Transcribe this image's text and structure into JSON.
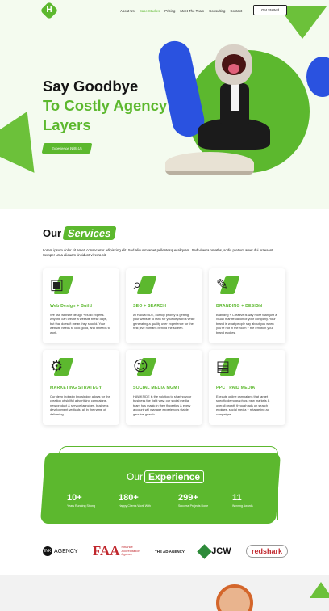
{
  "brand": {
    "logo_letter": "H",
    "accent": "#5cb82e"
  },
  "nav": {
    "items": [
      "About Us",
      "Case Studies",
      "Pricing",
      "Meet The Team",
      "Consulting",
      "Contact"
    ],
    "active": "Case Studies",
    "cta": "Get Started"
  },
  "hero": {
    "line1": "Say Goodbye",
    "line2": "To Costly Agency",
    "line3": "Layers",
    "button": "Experience With Us"
  },
  "services": {
    "title_plain": "Our",
    "title_tag": "Services",
    "intro": "Lorem ipsum dolor sit amet, consectetur adipiscing elit. Sed aliquam amet pellentesque aliquam. Sed viverra ornaths, sodis pretium amet dui praesent. Semper urna aliquam tincidunt viverra sit.",
    "cards": [
      {
        "icon": "web-design-icon",
        "glyph": "▣",
        "title": "Web Design + Build",
        "text": "We use website design + build experts. Anyone can create a website these days, but that doesn't mean they should. Your website needs to look good, and it needs to work."
      },
      {
        "icon": "seo-search-icon",
        "glyph": "⌕",
        "title": "SEO + SEARCH",
        "text": "At HAWKSIDE, our top priority is getting your website to rank for your keywords while generating a quality user experience for the rest; live humans behind the screen."
      },
      {
        "icon": "branding-design-icon",
        "glyph": "✎",
        "title": "BRANDING + DESIGN",
        "text": "Branding + Creative is way more than just a visual manifestation of your company. Your brand is what people say about you when you're not in the room + the emotion your brand evokes."
      },
      {
        "icon": "marketing-strategy-icon",
        "glyph": "⚙",
        "title": "MARKETING STRATEGY",
        "text": "Our deep industry knowledge allows for the creation of skillful advertising campaigns, new product & service launches, business development verticals, all in the name of delivering"
      },
      {
        "icon": "social-media-icon",
        "glyph": "☺",
        "title": "SOCIAL MEDIA MGMT",
        "text": "HAWKSIDE is the solution to sharing your business the right way: our social media team has magic in their fingertips & every account will manage experiences stable, genuine growth."
      },
      {
        "icon": "ppc-paid-media-icon",
        "glyph": "▤",
        "title": "PPC / PAID MEDIA",
        "text": "Execute online campaigns that target specific demographics, new markets & overall growth through ads on search engines, social media + retargeting ad campaigns."
      }
    ]
  },
  "experience": {
    "title_plain": "Our",
    "title_tag": "Experience",
    "stats": [
      {
        "num": "10+",
        "label": "Years Running Strong"
      },
      {
        "num": "180+",
        "label": "Happy Clients Work With"
      },
      {
        "num": "299+",
        "label": "Success Projects Done"
      },
      {
        "num": "11",
        "label": "Winning Awards"
      }
    ]
  },
  "logos": {
    "ink": "AGENCY",
    "faa_big": "FAA",
    "faa_small1": "Finance",
    "faa_small2": "Accreditation",
    "faa_small3": "Agency",
    "ad": "THE AD AGENCY",
    "jcw": "JCW",
    "redshark": "redshark"
  }
}
